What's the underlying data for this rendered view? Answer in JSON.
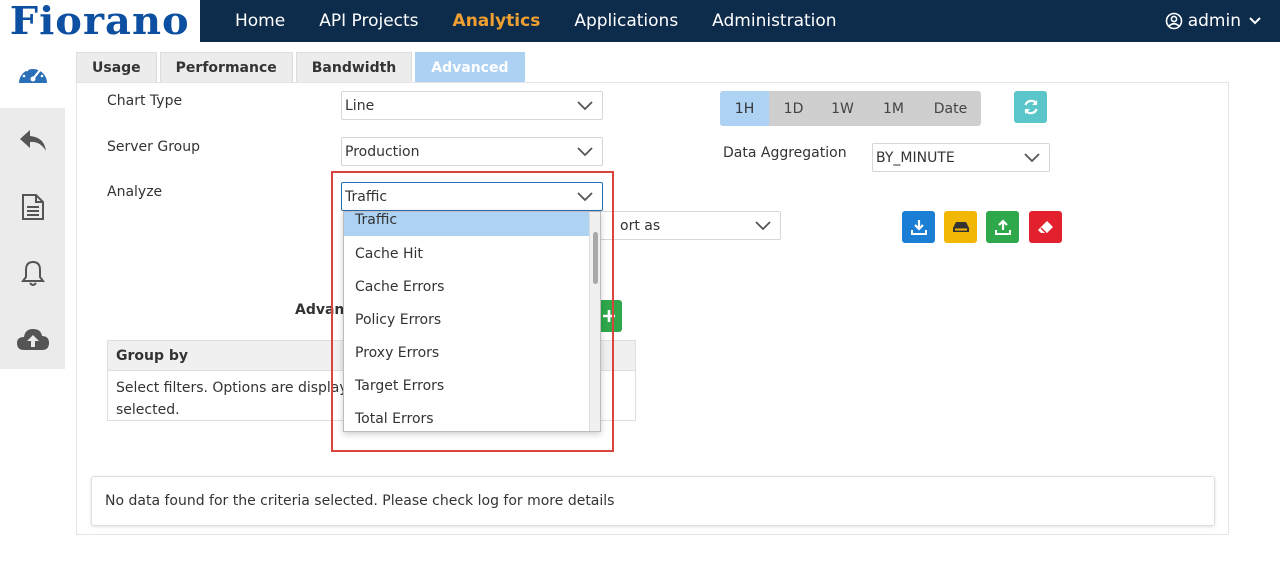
{
  "brand": {
    "logo_text": "Fiorano"
  },
  "nav": {
    "items": [
      {
        "label": "Home"
      },
      {
        "label": "API Projects"
      },
      {
        "label": "Analytics"
      },
      {
        "label": "Applications"
      },
      {
        "label": "Administration"
      }
    ],
    "active": "Analytics",
    "user": "admin"
  },
  "sidebar": {
    "icons": [
      "dashboard-icon",
      "reply-icon",
      "document-icon",
      "bell-icon",
      "cloud-upload-icon"
    ]
  },
  "tabs": [
    {
      "label": "Usage"
    },
    {
      "label": "Performance"
    },
    {
      "label": "Bandwidth"
    },
    {
      "label": "Advanced"
    }
  ],
  "active_tab": "Advanced",
  "form": {
    "chart_type_label": "Chart Type",
    "chart_type_value": "Line",
    "server_group_label": "Server Group",
    "server_group_value": "Production",
    "analyze_label": "Analyze",
    "analyze_value": "Traffic",
    "sort_partial": "ort as",
    "advanced_partial": "Advanc",
    "data_aggregation_label": "Data Aggregation",
    "data_aggregation_value": "BY_MINUTE"
  },
  "time_range": {
    "options": [
      "1H",
      "1D",
      "1W",
      "1M",
      "Date"
    ],
    "selected": "1H"
  },
  "analyze_dropdown": {
    "options": [
      "Traffic",
      "Cache Hit",
      "Cache Errors",
      "Policy Errors",
      "Proxy Errors",
      "Target Errors",
      "Total Errors"
    ],
    "selected": "Traffic"
  },
  "group_by": {
    "header": "Group by",
    "line1": "Select filters. Options are displaye",
    "line2": "selected."
  },
  "message": "No data found for the criteria selected. Please check log for more details",
  "colors": {
    "navbar": "#0d2b4a",
    "accent": "#f0a030",
    "tab_active": "#acd1f2",
    "download_btn": "#1a7fd4",
    "save_btn": "#f2b705",
    "upload_btn": "#2ea84a",
    "clear_btn": "#e3202e",
    "refresh_btn": "#5bc6c9",
    "add_btn": "#2ea84a",
    "highlight_box": "#d9453c"
  }
}
